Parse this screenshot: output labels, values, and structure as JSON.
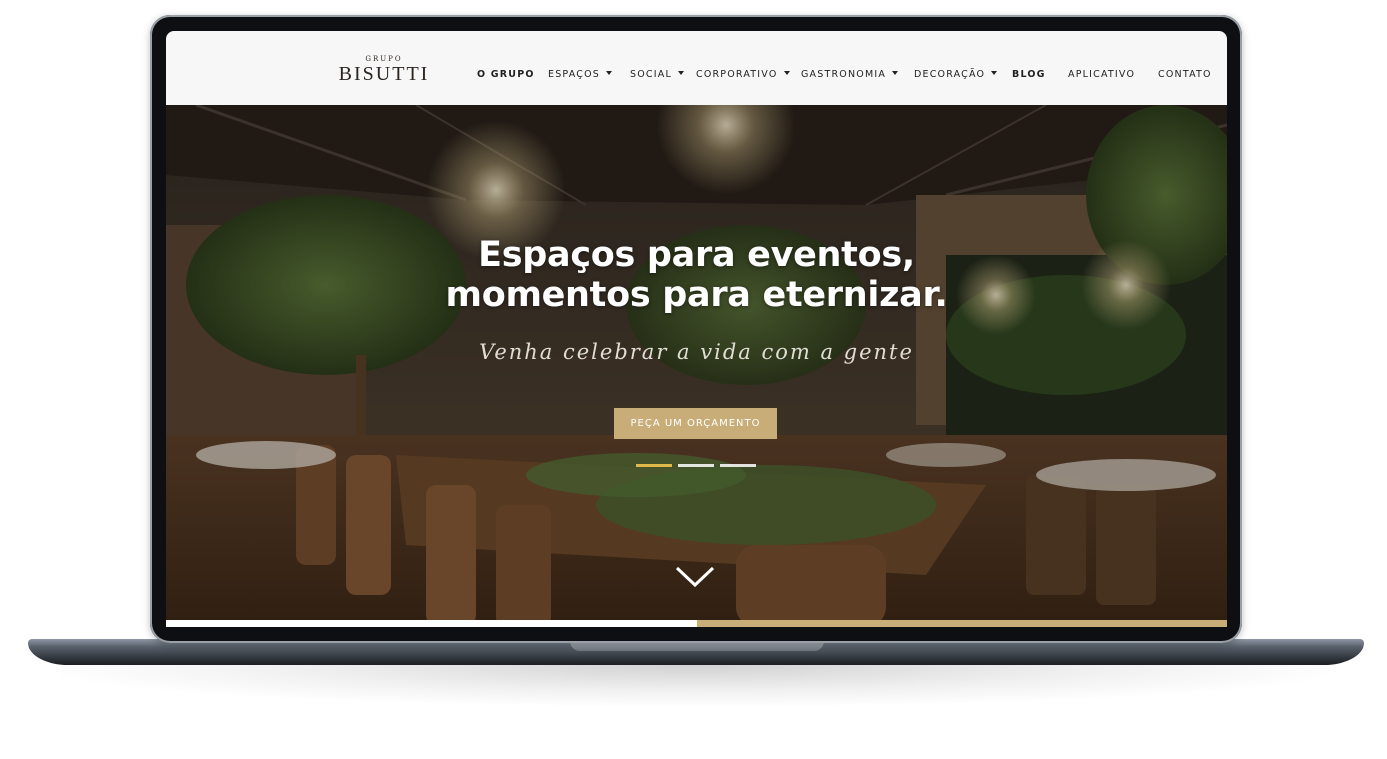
{
  "logo": {
    "top_text": "GRUPO",
    "main_text": "BISUTTI"
  },
  "nav": {
    "items": [
      {
        "label": "O GRUPO",
        "dropdown": false
      },
      {
        "label": "ESPAÇOS",
        "dropdown": true
      },
      {
        "label": "SOCIAL",
        "dropdown": true
      },
      {
        "label": "CORPORATIVO",
        "dropdown": true
      },
      {
        "label": "GASTRONOMIA",
        "dropdown": true
      },
      {
        "label": "DECORAÇÃO",
        "dropdown": true
      },
      {
        "label": "BLOG",
        "dropdown": false
      },
      {
        "label": "APLICATIVO",
        "dropdown": false
      },
      {
        "label": "CONTATO",
        "dropdown": false
      }
    ]
  },
  "hero": {
    "title_line1": "Espaços para eventos,",
    "title_line2": "momentos para eternizar.",
    "script_text": "Venha celebrar a vida com a gente",
    "cta_label": "PEÇA UM ORÇAMENTO",
    "slide_count": 3,
    "active_slide": 1
  },
  "icons": {
    "scroll_down": "chevron-down-icon",
    "dropdown": "caret-down-icon"
  },
  "colors": {
    "accent": "#c8ad78",
    "active_dot": "#e0b84a",
    "header_bg": "#f7f7f7",
    "nav_text": "#222222"
  },
  "progress": {
    "fraction": 0.5
  }
}
